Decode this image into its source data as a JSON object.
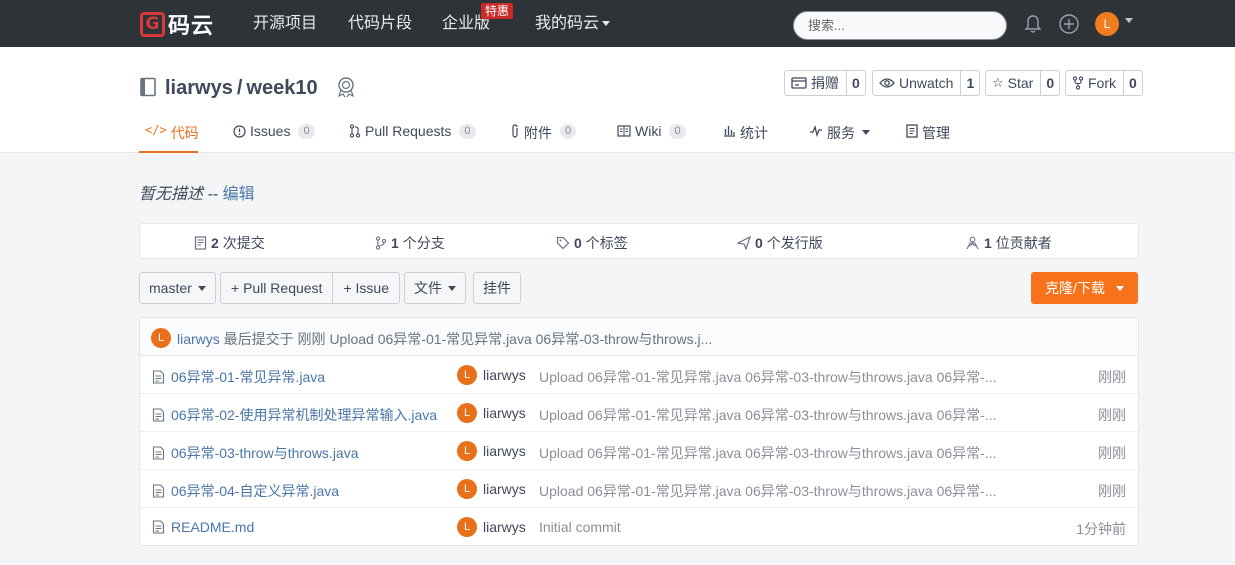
{
  "nav": {
    "logo_mark": "G",
    "logo_text": "码云",
    "items": [
      "开源项目",
      "代码片段",
      "企业版",
      "我的码云"
    ],
    "badge": "特惠",
    "search_placeholder": "搜索...",
    "avatar_letter": "L"
  },
  "repo": {
    "owner": "liarwys",
    "separator": "/",
    "name": "week10"
  },
  "actions": [
    {
      "label": "捐赠",
      "count": "0",
      "icon": "donate-icon"
    },
    {
      "label": "Unwatch",
      "count": "1",
      "icon": "eye-icon"
    },
    {
      "label": "Star",
      "count": "0",
      "icon": "star-icon"
    },
    {
      "label": "Fork",
      "count": "0",
      "icon": "fork-icon"
    }
  ],
  "tabs": [
    {
      "label": "代码",
      "icon": "code-icon",
      "active": true
    },
    {
      "label": "Issues",
      "count": "0",
      "icon": "issue-icon"
    },
    {
      "label": "Pull Requests",
      "count": "0",
      "icon": "pull-request-icon"
    },
    {
      "label": "附件",
      "count": "0",
      "icon": "attachment-icon"
    },
    {
      "label": "Wiki",
      "count": "0",
      "icon": "wiki-icon"
    },
    {
      "label": "统计",
      "icon": "chart-icon"
    },
    {
      "label": "服务",
      "icon": "service-icon"
    },
    {
      "label": "管理",
      "icon": "settings-icon"
    }
  ],
  "description": {
    "text": "暂无描述 --",
    "edit": "编辑"
  },
  "stats": [
    {
      "count": "2",
      "label": "次提交"
    },
    {
      "count": "1",
      "label": "个分支"
    },
    {
      "count": "0",
      "label": "个标签"
    },
    {
      "count": "0",
      "label": "个发行版"
    },
    {
      "count": "1",
      "label": "位贡献者"
    }
  ],
  "toolbar": {
    "branch": "master",
    "pull_request": "+ Pull Request",
    "issue": "+ Issue",
    "files": "文件",
    "widget": "挂件",
    "clone": "克隆/下载"
  },
  "last_commit": {
    "avatar": "L",
    "user": "liarwys",
    "text": "最后提交于 刚刚 Upload 06异常-01-常见异常.java 06异常-03-throw与throws.j..."
  },
  "files": [
    {
      "name": "06异常-01-常见异常.java",
      "avatar": "L",
      "author": "liarwys",
      "message": "Upload 06异常-01-常见异常.java 06异常-03-throw与throws.java 06异常-...",
      "time": "刚刚"
    },
    {
      "name": "06异常-02-使用异常机制处理异常输入.java",
      "avatar": "L",
      "author": "liarwys",
      "message": "Upload 06异常-01-常见异常.java 06异常-03-throw与throws.java 06异常-...",
      "time": "刚刚"
    },
    {
      "name": "06异常-03-throw与throws.java",
      "avatar": "L",
      "author": "liarwys",
      "message": "Upload 06异常-01-常见异常.java 06异常-03-throw与throws.java 06异常-...",
      "time": "刚刚"
    },
    {
      "name": "06异常-04-自定义异常.java",
      "avatar": "L",
      "author": "liarwys",
      "message": "Upload 06异常-01-常见异常.java 06异常-03-throw与throws.java 06异常-...",
      "time": "刚刚"
    },
    {
      "name": "README.md",
      "avatar": "L",
      "author": "liarwys",
      "message": "Initial commit",
      "time": "1分钟前"
    }
  ]
}
